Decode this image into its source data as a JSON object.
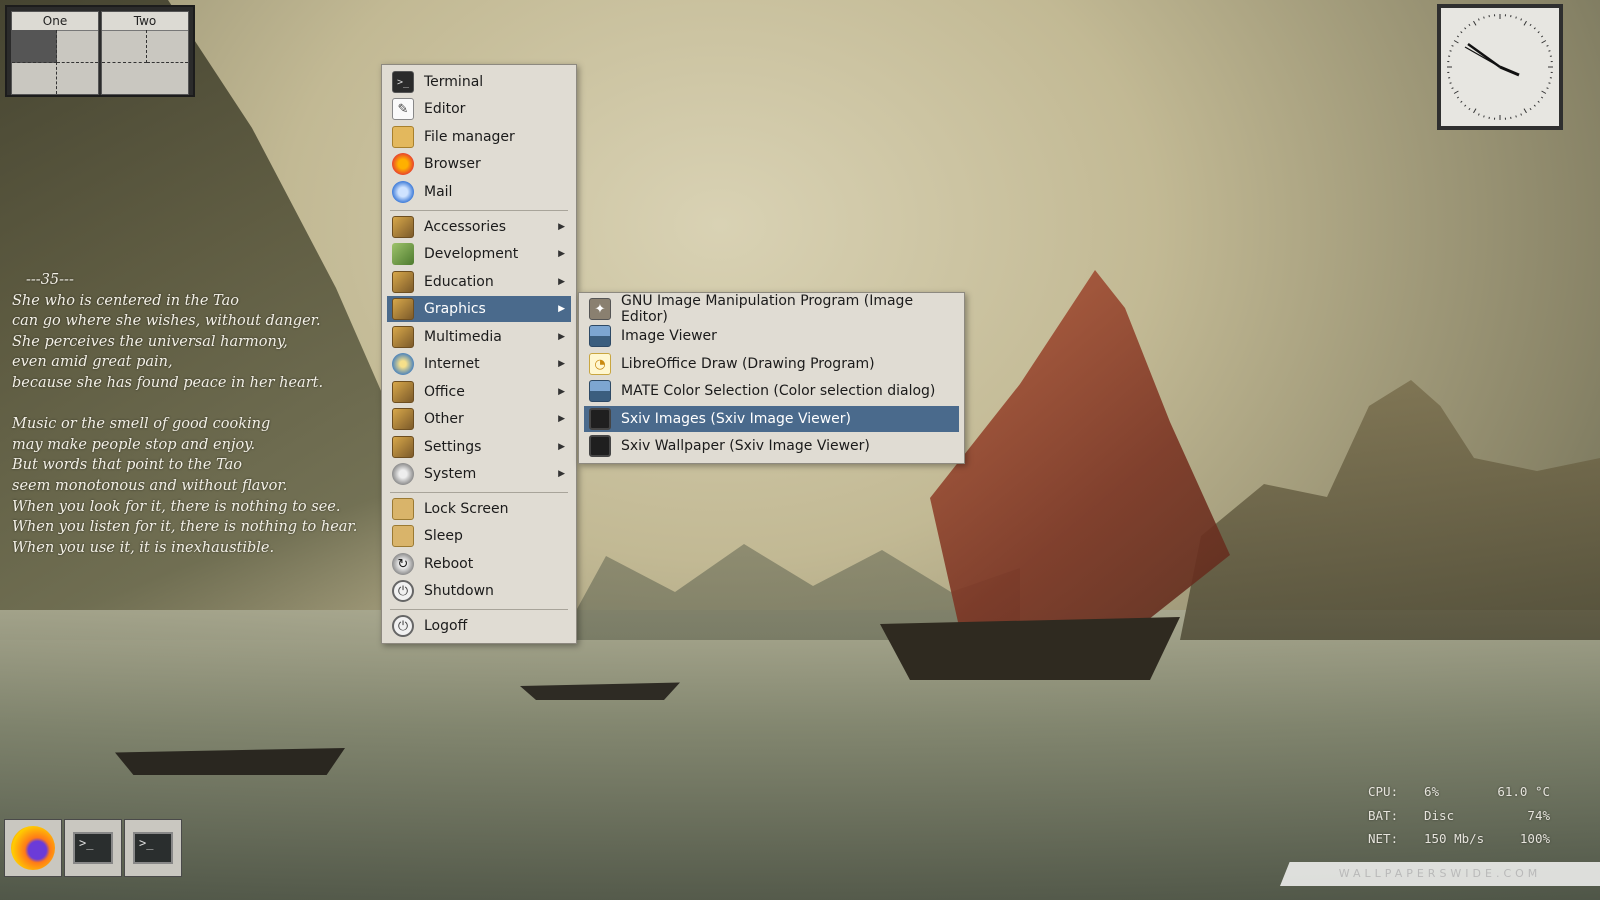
{
  "pager": {
    "workspaces": [
      "One",
      "Two"
    ]
  },
  "poem": {
    "heading": "---35---",
    "stanza1": [
      "She who is centered in the Tao",
      "can go where she wishes, without danger.",
      "She perceives the universal harmony,",
      "even amid great pain,",
      "because she has found peace in her heart."
    ],
    "stanza2": [
      "Music or the smell of good cooking",
      "may make people stop and enjoy.",
      "But words that point to the Tao",
      "seem monotonous and without flavor.",
      "When you look for it, there is nothing to see.",
      "When you listen for it, there is nothing to hear.",
      "When you use it, it is inexhaustible."
    ]
  },
  "menu": {
    "apps": [
      {
        "label": "Terminal",
        "icon": "terminal-icon"
      },
      {
        "label": "Editor",
        "icon": "editor-icon"
      },
      {
        "label": "File manager",
        "icon": "folder-icon"
      },
      {
        "label": "Browser",
        "icon": "firefox-icon"
      },
      {
        "label": "Mail",
        "icon": "mail-icon"
      }
    ],
    "categories": [
      {
        "label": "Accessories",
        "icon": "accessories-icon"
      },
      {
        "label": "Development",
        "icon": "development-icon"
      },
      {
        "label": "Education",
        "icon": "education-icon"
      },
      {
        "label": "Graphics",
        "icon": "graphics-icon"
      },
      {
        "label": "Multimedia",
        "icon": "multimedia-icon"
      },
      {
        "label": "Internet",
        "icon": "globe-icon"
      },
      {
        "label": "Office",
        "icon": "office-icon"
      },
      {
        "label": "Other",
        "icon": "other-icon"
      },
      {
        "label": "Settings",
        "icon": "settings-icon"
      },
      {
        "label": "System",
        "icon": "gear-icon"
      }
    ],
    "session": [
      {
        "label": "Lock Screen",
        "icon": "lock-icon"
      },
      {
        "label": "Sleep",
        "icon": "lock-icon"
      },
      {
        "label": "Reboot",
        "icon": "reboot-icon"
      },
      {
        "label": "Shutdown",
        "icon": "power-icon"
      }
    ],
    "logoff": {
      "label": "Logoff",
      "icon": "power-icon"
    },
    "submenu_arrow": "▶",
    "selected_category": "Graphics"
  },
  "submenu": {
    "items": [
      {
        "label": "GNU Image Manipulation Program (Image Editor)",
        "icon": "gimp-icon"
      },
      {
        "label": "Image Viewer",
        "icon": "image-viewer-icon"
      },
      {
        "label": "LibreOffice Draw (Drawing Program)",
        "icon": "draw-icon"
      },
      {
        "label": "MATE Color Selection (Color selection dialog)",
        "icon": "color-selection-icon"
      },
      {
        "label": "Sxiv Images (Sxiv Image Viewer)",
        "icon": "screen-icon"
      },
      {
        "label": "Sxiv Wallpaper (Sxiv Image Viewer)",
        "icon": "screen-icon"
      }
    ],
    "selected": "Sxiv Images (Sxiv Image Viewer)"
  },
  "status": {
    "cpu": {
      "key": "CPU:",
      "a": "6%",
      "b": "61.0 °C"
    },
    "bat": {
      "key": "BAT:",
      "a": "Disc",
      "b": "74%"
    },
    "net": {
      "key": "NET:",
      "a": "150 Mb/s",
      "b": "100%"
    }
  },
  "watermark": "WALLPAPERSWIDE.COM",
  "dock": [
    {
      "name": "Firefox",
      "icon": "firefox-icon"
    },
    {
      "name": "Terminal",
      "icon": "terminal-icon"
    },
    {
      "name": "Terminal",
      "icon": "terminal-icon"
    }
  ],
  "colors": {
    "selection": "#4a6a8c",
    "menu_bg": "#e0dcd3"
  }
}
